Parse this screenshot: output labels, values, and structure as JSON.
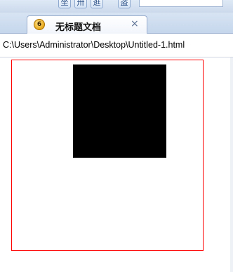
{
  "toolbar": {
    "buttons": [
      {
        "icon": "bookmark-icon",
        "glyph": "坐"
      },
      {
        "icon": "split-icon",
        "glyph": "卅"
      },
      {
        "icon": "toggle-icon",
        "glyph": "逛"
      },
      {
        "icon": "preview-icon",
        "glyph": "盗"
      }
    ]
  },
  "tab": {
    "icon_label": "6",
    "title": "无标题文档",
    "close_glyph": "×"
  },
  "address": {
    "url": "C:\\Users\\Administrator\\Desktop\\Untitled-1.html"
  },
  "content": {
    "outer_border_color": "#ff0000",
    "inner_box_color": "#000000"
  }
}
